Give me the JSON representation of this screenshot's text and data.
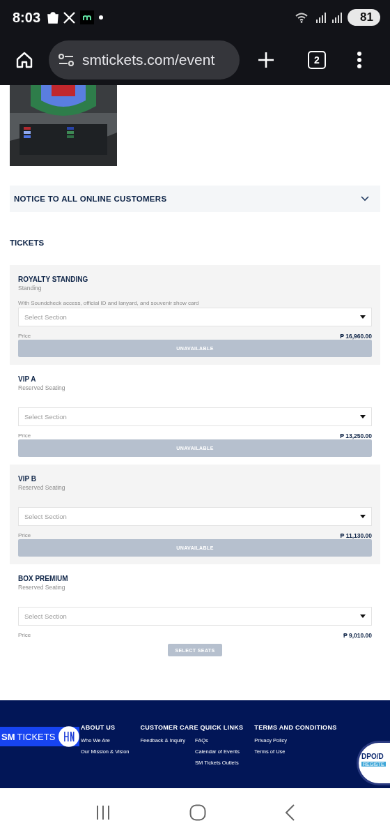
{
  "status_bar": {
    "time": "8:03",
    "battery": "81"
  },
  "browser": {
    "url": "smtickets.com/event",
    "tab_count": "2"
  },
  "notice": {
    "title": "NOTICE TO ALL ONLINE CUSTOMERS",
    "expanded": false
  },
  "tickets_heading": "TICKETS",
  "tickets": [
    {
      "name": "ROYALTY STANDING",
      "type": "Standing",
      "description": "With Soundcheck access, official ID and lanyard, and souvenir show card",
      "placeholder": "Select Section",
      "price_label": "Price",
      "price": "₱ 16,960.00",
      "button": {
        "kind": "unavailable",
        "label": "UNAVAILABLE"
      }
    },
    {
      "name": "VIP A",
      "type": "Reserved Seating",
      "placeholder": "Select Section",
      "price_label": "Price",
      "price": "₱ 13,250.00",
      "button": {
        "kind": "unavailable",
        "label": "UNAVAILABLE"
      }
    },
    {
      "name": "VIP B",
      "type": "Reserved Seating",
      "placeholder": "Select Section",
      "price_label": "Price",
      "price": "₱ 11,130.00",
      "button": {
        "kind": "unavailable",
        "label": "UNAVAILABLE"
      }
    },
    {
      "name": "BOX PREMIUM",
      "type": "Reserved Seating",
      "placeholder": "Select Section",
      "price_label": "Price",
      "price": "₱ 9,010.00",
      "button": {
        "kind": "select",
        "label": "SELECT SEATS"
      }
    }
  ],
  "footer": {
    "logo_text_bold": "SM",
    "logo_text": "TICKETS",
    "columns": [
      {
        "heading": "ABOUT US",
        "links": [
          [
            "Who We Are",
            "Our Mission & Vision"
          ]
        ]
      },
      {
        "heading": "CUSTOMER CARE QUICK LINKS",
        "links": [
          [
            "Feedback & Inquiry"
          ],
          [
            "FAQs",
            "Calendar of Events",
            "SM Tickets Outlets"
          ]
        ]
      },
      {
        "heading": "TERMS AND CONDITIONS",
        "links": [
          [
            "Privacy Policy",
            "Terms of Use"
          ]
        ]
      }
    ],
    "seal": {
      "title": "DPO/D",
      "ribbon": "REGISTE"
    }
  }
}
